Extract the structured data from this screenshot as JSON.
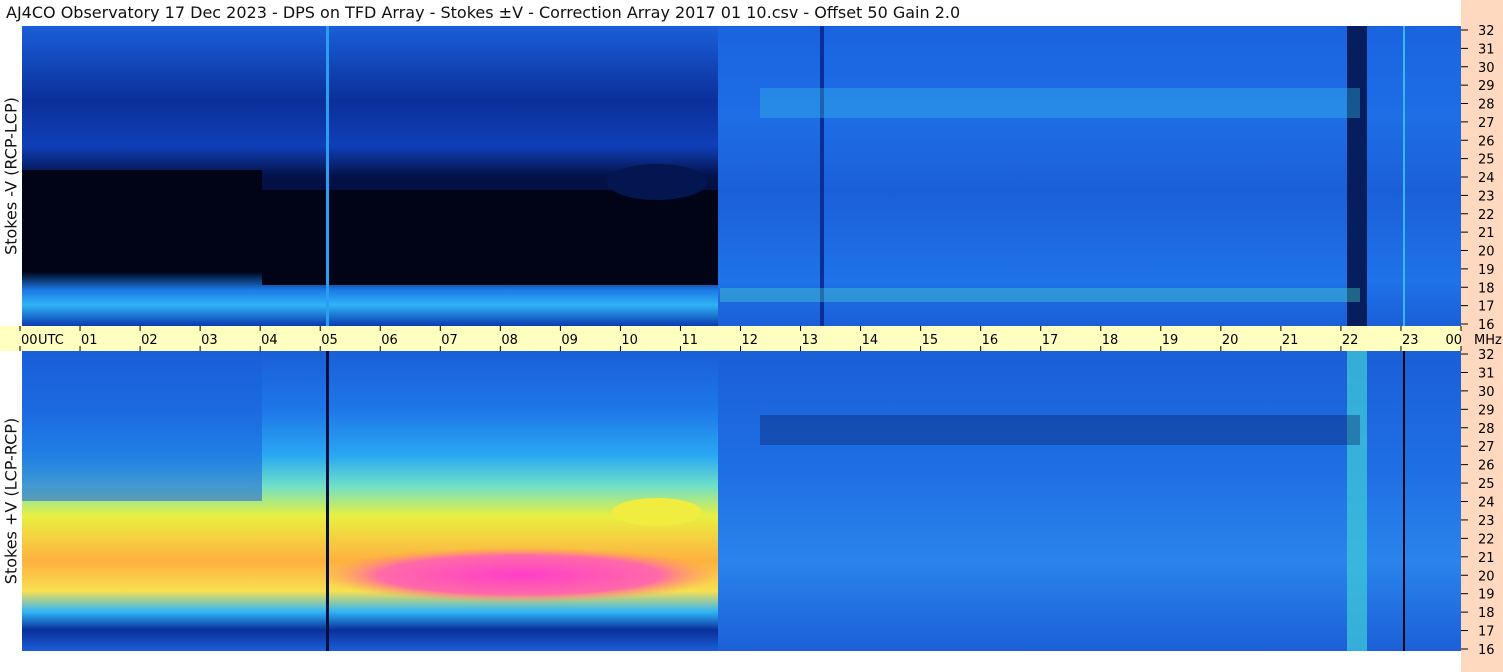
{
  "title": "AJ4CO Observatory  17 Dec 2023  -  DPS on TFD Array  -  Stokes ±V  -  Correction Array 2017 01 10.csv  -  Offset 50  Gain 2.0",
  "panels": {
    "top_label": "Stokes -V (RCP-LCP)",
    "bottom_label": "Stokes +V (LCP-RCP)"
  },
  "time_axis": {
    "labels": [
      "00",
      "01",
      "02",
      "03",
      "04",
      "05",
      "06",
      "07",
      "08",
      "09",
      "10",
      "11",
      "12",
      "13",
      "14",
      "15",
      "16",
      "17",
      "18",
      "19",
      "20",
      "21",
      "22",
      "23",
      "00"
    ],
    "utc_label": "UTC",
    "mhz_label": "MHz"
  },
  "freq_axis": {
    "labels": [
      "16",
      "17",
      "18",
      "19",
      "20",
      "21",
      "22",
      "23",
      "24",
      "25",
      "26",
      "27",
      "28",
      "29",
      "30",
      "31",
      "32"
    ]
  },
  "colors": {
    "axis_bg": "#ffffc0",
    "right_bg": "#ffd9bf",
    "base_blue": "#1a5fe6",
    "dark": "#000818",
    "magenta": "#ff3ec8"
  },
  "chart_data": [
    {
      "type": "heatmap",
      "title": "Stokes -V (RCP-LCP)",
      "x_range_utc_hours": [
        0,
        24
      ],
      "y_range_mhz": [
        16,
        32
      ],
      "features": [
        {
          "hours": [
            0,
            11.6
          ],
          "mhz": [
            19.5,
            24.5
          ],
          "level": "very dark (low)"
        },
        {
          "hours": [
            9.9,
            11.1
          ],
          "mhz": [
            23.5,
            25.5
          ],
          "level": "dark"
        },
        {
          "hours": [
            0,
            11.6
          ],
          "mhz": [
            17,
            18
          ],
          "level": "bright cyan band"
        },
        {
          "hours": [
            22.1,
            22.4
          ],
          "mhz": [
            16.5,
            32
          ],
          "level": "dark column"
        }
      ]
    },
    {
      "type": "heatmap",
      "title": "Stokes +V (LCP-RCP)",
      "x_range_utc_hours": [
        0,
        24
      ],
      "y_range_mhz": [
        16,
        32
      ],
      "features": [
        {
          "hours": [
            3.7,
            11.6
          ],
          "mhz": [
            19,
            22
          ],
          "level": "high (magenta/yellow)"
        },
        {
          "hours": [
            0,
            11.6
          ],
          "mhz": [
            18,
            24.5
          ],
          "level": "yellow/cyan"
        },
        {
          "hours": [
            9.9,
            11.1
          ],
          "mhz": [
            23,
            24.5
          ],
          "level": "yellow"
        },
        {
          "hours": [
            22.1,
            22.4
          ],
          "mhz": [
            16.5,
            32
          ],
          "level": "cyan/green column"
        }
      ]
    }
  ]
}
